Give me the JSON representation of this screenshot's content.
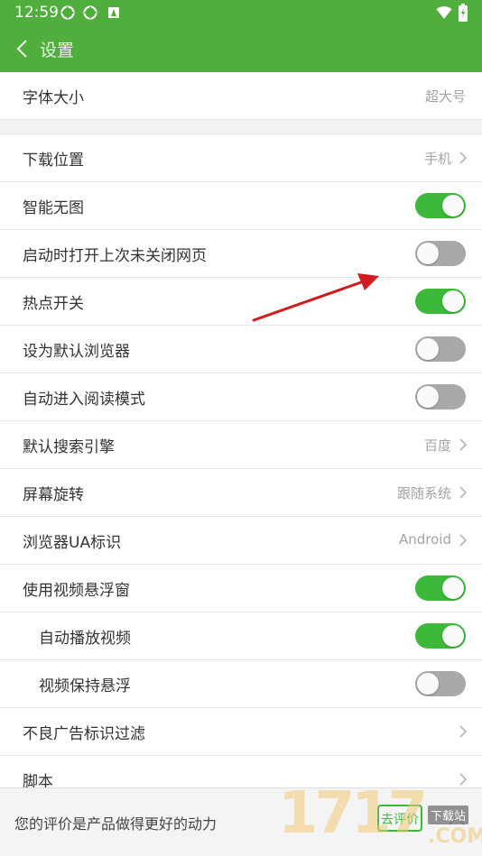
{
  "status": {
    "time": "12:59"
  },
  "header": {
    "title": "设置"
  },
  "settings": {
    "font_size": {
      "label": "字体大小",
      "value": "超大号"
    },
    "download_location": {
      "label": "下载位置",
      "value": "手机"
    },
    "smart_no_image": {
      "label": "智能无图",
      "on": true
    },
    "reopen_tabs": {
      "label": "启动时打开上次未关闭网页",
      "on": false
    },
    "hotspot": {
      "label": "热点开关",
      "on": true
    },
    "default_browser": {
      "label": "设为默认浏览器",
      "on": false
    },
    "auto_reader": {
      "label": "自动进入阅读模式",
      "on": false
    },
    "search_engine": {
      "label": "默认搜索引擎",
      "value": "百度"
    },
    "rotation": {
      "label": "屏幕旋转",
      "value": "跟随系统"
    },
    "ua": {
      "label": "浏览器UA标识",
      "value": "Android"
    },
    "video_float": {
      "label": "使用视频悬浮窗",
      "on": true
    },
    "auto_play": {
      "label": "自动播放视频",
      "on": true
    },
    "keep_float": {
      "label": "视频保持悬浮",
      "on": false
    },
    "ad_filter": {
      "label": "不良广告标识过滤"
    },
    "script": {
      "label": "脚本"
    }
  },
  "bottom": {
    "message": "您的评价是产品做得更好的动力",
    "rate_label": "去评价"
  },
  "watermark": {
    "text": "1717",
    "badge": "下载站",
    "com": ".COM"
  },
  "colors": {
    "primary": "#4fae3c",
    "toggle_on": "#3cb93a",
    "toggle_off": "#a9a9a9",
    "arrow": "#d01c1c"
  }
}
